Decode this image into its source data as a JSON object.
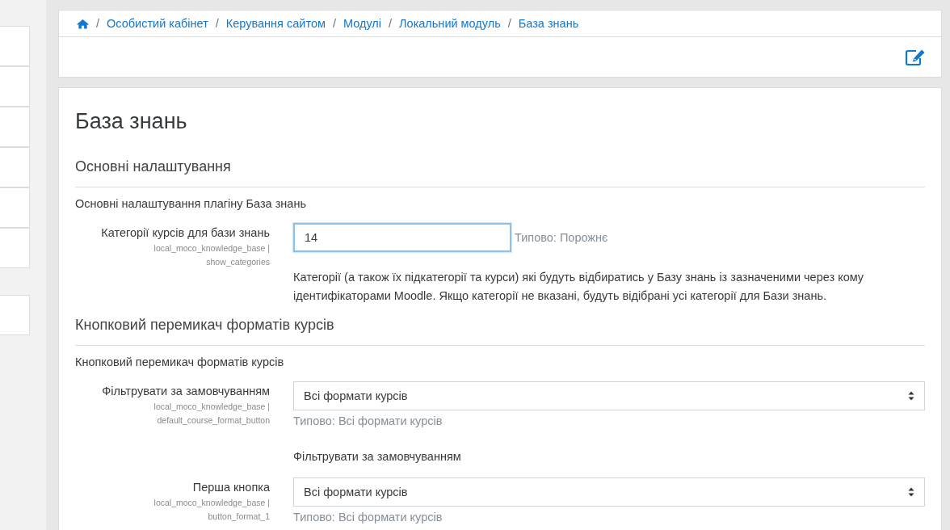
{
  "sidebar": {
    "groups": [
      {
        "items": [
          {
            "kind": "item"
          },
          {
            "kind": "item"
          },
          {
            "kind": "item"
          },
          {
            "kind": "item"
          },
          {
            "kind": "item"
          },
          {
            "kind": "item"
          }
        ]
      },
      {
        "items": [
          {
            "kind": "item"
          }
        ]
      }
    ]
  },
  "breadcrumb": [
    {
      "separator": "/",
      "label": "Особистий кабінет"
    },
    {
      "separator": "/",
      "label": "Керування сайтом"
    },
    {
      "separator": "/",
      "label": "Модулі"
    },
    {
      "separator": "/",
      "label": "Локальний модуль"
    },
    {
      "separator": "/",
      "label": "База знань"
    }
  ],
  "page_title": "База знань",
  "sections": [
    {
      "heading": "Основні налаштування",
      "description": "Основні налаштування плагіну База знань",
      "settings": [
        {
          "kind": "text",
          "label": "Категорії курсів для бази знань",
          "name": "local_moco_knowledge_base | show_categories",
          "value": "14",
          "focused": true,
          "default": "Типово: Порожнє",
          "help": "Категорії (а також їх підкатегорії та курси) які будуть відбиратись у Базу знань із зазначеними через кому ідентифікаторами Moodle. Якщо категорії не вказані, будуть відібрані усі категорії для Бази знань."
        }
      ]
    },
    {
      "heading": "Кнопковий перемикач форматів курсів",
      "description": "Кнопковий перемикач форматів курсів",
      "settings": [
        {
          "kind": "select",
          "label": "Фільтрувати за замовчуванням",
          "name": "local_moco_knowledge_base | default_course_format_button",
          "value": "Всі формати курсів",
          "default": "Типово: Всі формати курсів",
          "help": "Фільтрувати за замовчуванням"
        },
        {
          "kind": "select",
          "label": "Перша кнопка",
          "name": "local_moco_knowledge_base | button_format_1",
          "value": "Всі формати курсів",
          "default": "Типово: Всі формати курсів"
        }
      ]
    }
  ]
}
